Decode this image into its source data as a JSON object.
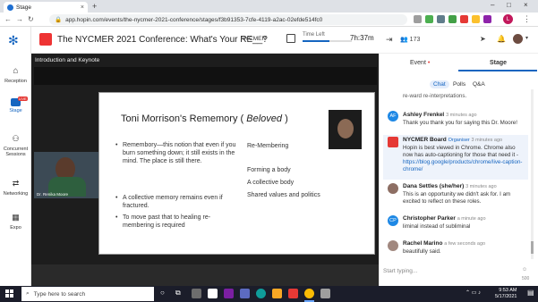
{
  "browser": {
    "tab_title": "Stage",
    "new_tab": "+",
    "url": "app.hopin.com/events/the-nycmer-2021-conference/stages/f3b91353-7cfe-4119-a2ac-02efde514fc0",
    "profile_initial": "L"
  },
  "nav": {
    "items": [
      {
        "label": "Reception"
      },
      {
        "label": "Stage",
        "badge": "LIVE"
      },
      {
        "label": "Concurrent Sessions"
      },
      {
        "label": "Networking"
      },
      {
        "label": "Expo"
      }
    ]
  },
  "header": {
    "event_title": "The NYCMER 2021 Conference: What's Your RE__?",
    "organizer": "NYCMER",
    "time_left_label": "Time Left",
    "time_left_value": "7h:37m",
    "time_left_progress": 0.55
  },
  "stage": {
    "label": "Introduction and Keynote",
    "speaker_name": "Dr. Renika Moore"
  },
  "slide": {
    "title_main": "Toni Morrison's Rememory (",
    "title_italic": "Beloved",
    "title_end": ")",
    "bullets": [
      "Remembory—this notion that even if you burn something down; it still exists in the mind. The place is still there.",
      "A collective memory remains even if fractured.",
      "To move past that to healing re-membering is required"
    ],
    "right_items": [
      "Re-Membering",
      "Forming a body",
      "A collective body",
      "Shared values and politics"
    ]
  },
  "right_panel": {
    "attendee_count": "173",
    "tabs": [
      "Event",
      "Stage"
    ],
    "subtabs": [
      "Chat",
      "Polls",
      "Q&A"
    ],
    "truncated_text": "re-ward re-interpretations.",
    "messages": [
      {
        "initials": "AF",
        "name": "Ashley Frenkel",
        "time": "3 minutes ago",
        "text": "Thank you thank you for saying this Dr. Moore!",
        "color": "#1e88e5"
      },
      {
        "initials": "",
        "name": "NYCMER Board",
        "role": "Organiser",
        "time": "3 minutes ago",
        "text": "Hopin is best viewed in Chrome. Chrome also now has auto-captioning for those that need it - ",
        "link": "https://blog.google/products/chrome/live-caption-chrome/",
        "color": "#e53935"
      },
      {
        "initials": "",
        "name": "Dana Settles (she/her)",
        "time": "3 minutes ago",
        "text": "This is an opportunity we didn't ask for. I am excited to reflect on these roles.",
        "color": "#8d6e63"
      },
      {
        "initials": "CP",
        "name": "Christopher Parker",
        "time": "a minute ago",
        "text": "liminal instead of subliminal",
        "color": "#1e88e5"
      },
      {
        "initials": "",
        "name": "Rachel Marino",
        "time": "a few seconds ago",
        "text": "beautifully said.",
        "color": "#a1887f"
      }
    ],
    "input_placeholder": "Start typing...",
    "char_limit": "500"
  },
  "taskbar": {
    "search_placeholder": "Type here to search",
    "time": "9:53 AM",
    "date": "5/17/2021"
  }
}
